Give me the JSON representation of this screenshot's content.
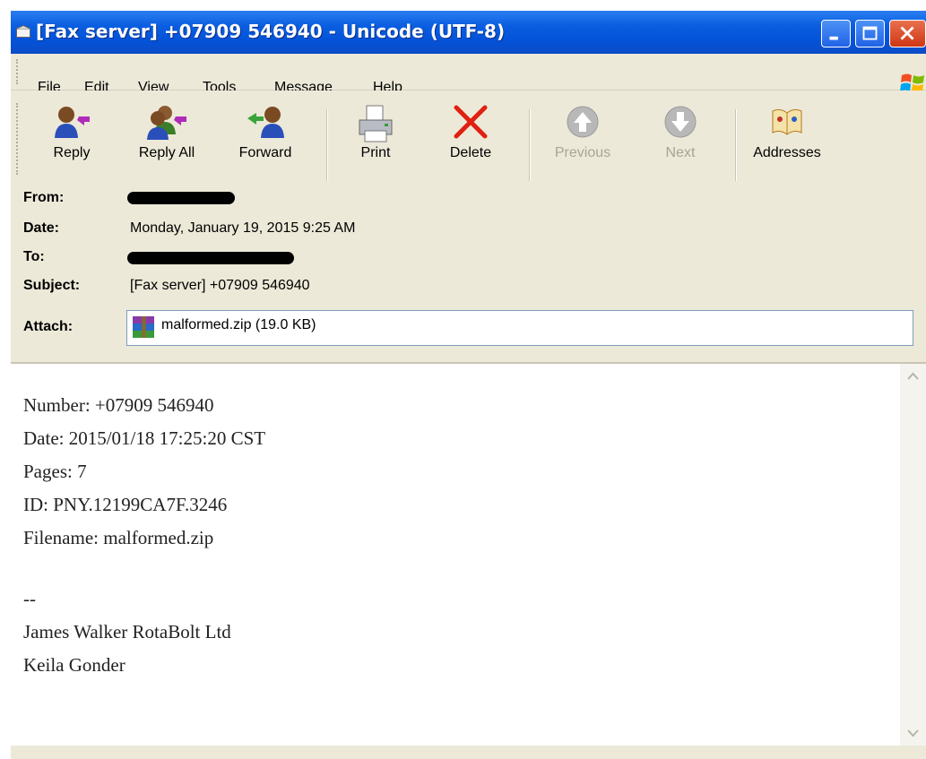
{
  "window": {
    "title": "[Fax server] +07909 546940 - Unicode (UTF-8)"
  },
  "menu": [
    "File",
    "Edit",
    "View",
    "Tools",
    "Message",
    "Help"
  ],
  "toolbar": {
    "reply": "Reply",
    "reply_all": "Reply All",
    "forward": "Forward",
    "print": "Print",
    "delete": "Delete",
    "previous": "Previous",
    "next": "Next",
    "addresses": "Addresses"
  },
  "header": {
    "from_label": "From:",
    "date_label": "Date:",
    "date_value": "Monday, January 19, 2015 9:25 AM",
    "to_label": "To:",
    "subject_label": "Subject:",
    "subject_value": "[Fax server] +07909 546940",
    "attach_label": "Attach:",
    "attachment": "malformed.zip (19.0 KB)"
  },
  "body": {
    "lines": [
      "Number: +07909 546940",
      "Date: 2015/01/18 17:25:20 CST",
      "Pages: 7",
      "ID: PNY.12199CA7F.3246",
      "Filename: malformed.zip",
      "--",
      "James Walker RotaBolt Ltd",
      "Keila Gonder"
    ]
  },
  "colors": {
    "titlebar": "#0452d8",
    "chrome": "#ece9d8",
    "delete_x": "#e02010"
  }
}
